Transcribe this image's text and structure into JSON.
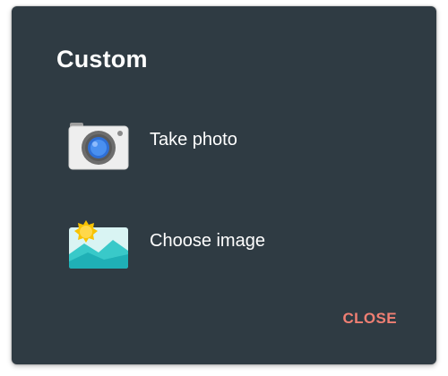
{
  "dialog": {
    "title": "Custom",
    "options": [
      {
        "label": "Take photo",
        "icon": "camera-icon"
      },
      {
        "label": "Choose image",
        "icon": "gallery-icon"
      }
    ],
    "close_label": "CLOSE"
  },
  "colors": {
    "dialog_background": "#2f3b43",
    "title_text": "#ffffff",
    "accent": "#f07f73"
  }
}
